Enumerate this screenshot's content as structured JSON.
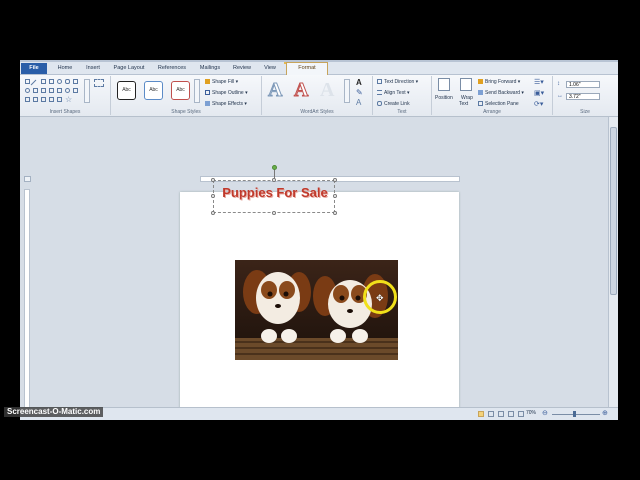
{
  "tabs": [
    {
      "label": "File"
    },
    {
      "label": "Home"
    },
    {
      "label": "Insert"
    },
    {
      "label": "Page Layout"
    },
    {
      "label": "References"
    },
    {
      "label": "Mailings"
    },
    {
      "label": "Review"
    },
    {
      "label": "View"
    },
    {
      "label": "Format"
    }
  ],
  "ribbon": {
    "insert_shapes_label": "Insert Shapes",
    "shape_styles_label": "Shape Styles",
    "style_sample": "Abc",
    "shape_fill": "Shape Fill",
    "shape_outline": "Shape Outline",
    "shape_effects": "Shape Effects",
    "wordart_label": "WordArt Styles",
    "text_direction": "Text Direction",
    "align_text": "Align Text",
    "create_link": "Create Link",
    "text_label": "Text",
    "position": "Position",
    "wrap_text_1": "Wrap",
    "wrap_text_2": "Text",
    "bring_forward": "Bring Forward",
    "send_backward": "Send Backward",
    "selection_pane": "Selection Pane",
    "arrange_label": "Arrange",
    "height_value": "1.06\"",
    "width_value": "3.72\"",
    "size_label": "Size"
  },
  "document": {
    "textbox_text": "Puppies For Sale"
  },
  "status": {
    "zoom": "70%"
  },
  "watermark": "Screencast-O-Matic.com",
  "colors": {
    "file_tab": "#2a5ea8",
    "wordart_text": "#c0392b",
    "cursor_highlight": "#f1e01a"
  }
}
